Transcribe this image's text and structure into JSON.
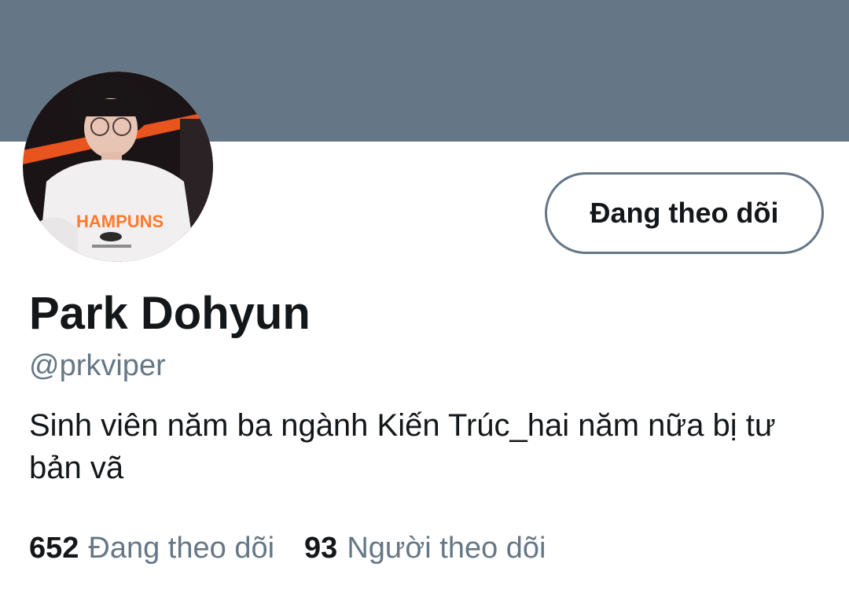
{
  "profile": {
    "name": "Park Dohyun",
    "handle": "@prkviper",
    "bio": "Sinh viên năm ba ngành Kiến Trúc_hai năm nữa bị tư bản vã",
    "follow_button_label": "Đang theo dõi"
  },
  "stats": {
    "following": {
      "count": "652",
      "label": "Đang theo dõi"
    },
    "followers": {
      "count": "93",
      "label": "Người theo dõi"
    }
  },
  "colors": {
    "banner": "#657786",
    "text_primary": "#14171a",
    "text_secondary": "#657786"
  }
}
